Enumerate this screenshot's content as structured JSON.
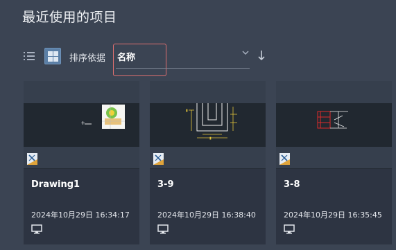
{
  "page": {
    "title": "最近使用的项目"
  },
  "toolbar": {
    "list_view_icon": "list-icon",
    "grid_view_icon": "grid-icon",
    "sort_label": "排序依据",
    "sort_value": "名称",
    "sort_direction_icon": "arrow-down-icon"
  },
  "cards": [
    {
      "name": "Drawing1",
      "date": "2024年10月29日 16:34:17"
    },
    {
      "name": "3-9",
      "date": "2024年10月29日 16:38:40"
    },
    {
      "name": "3-8",
      "date": "2024年10月29日 16:35:45"
    }
  ],
  "colors": {
    "background": "#3b4453",
    "card": "#2d3442",
    "accent": "#5b7fa6",
    "highlight_border": "#e07070"
  }
}
